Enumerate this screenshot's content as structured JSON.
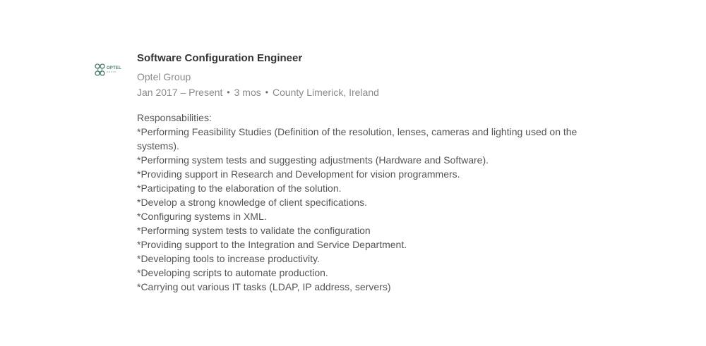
{
  "position": {
    "title": "Software Configuration Engineer",
    "company": "Optel Group",
    "logo": {
      "icon": "optel-group-logo",
      "word": "OPTEL",
      "sub": "GROUP",
      "color": "#4c7c6e"
    },
    "dates": "Jan 2017 – Present",
    "duration": "3 mos",
    "location": "County Limerick, Ireland",
    "separator": "•",
    "description": [
      "Responsabilities:",
      "*Performing Feasibility Studies (Definition of the resolution, lenses, cameras and lighting used on the",
      "systems).",
      "*Performing system tests and suggesting adjustments (Hardware and Software).",
      "*Providing support in Research and Development for vision programmers.",
      "*Participating to the elaboration of the solution.",
      "*Develop a strong knowledge of client specifications.",
      "*Configuring systems in XML.",
      "*Performing system tests to validate the configuration",
      "*Providing support to the Integration and Service Department.",
      "*Developing tools to increase productivity.",
      "*Developing scripts to automate production.",
      "*Carrying out various IT tasks (LDAP, IP address, servers)"
    ]
  }
}
